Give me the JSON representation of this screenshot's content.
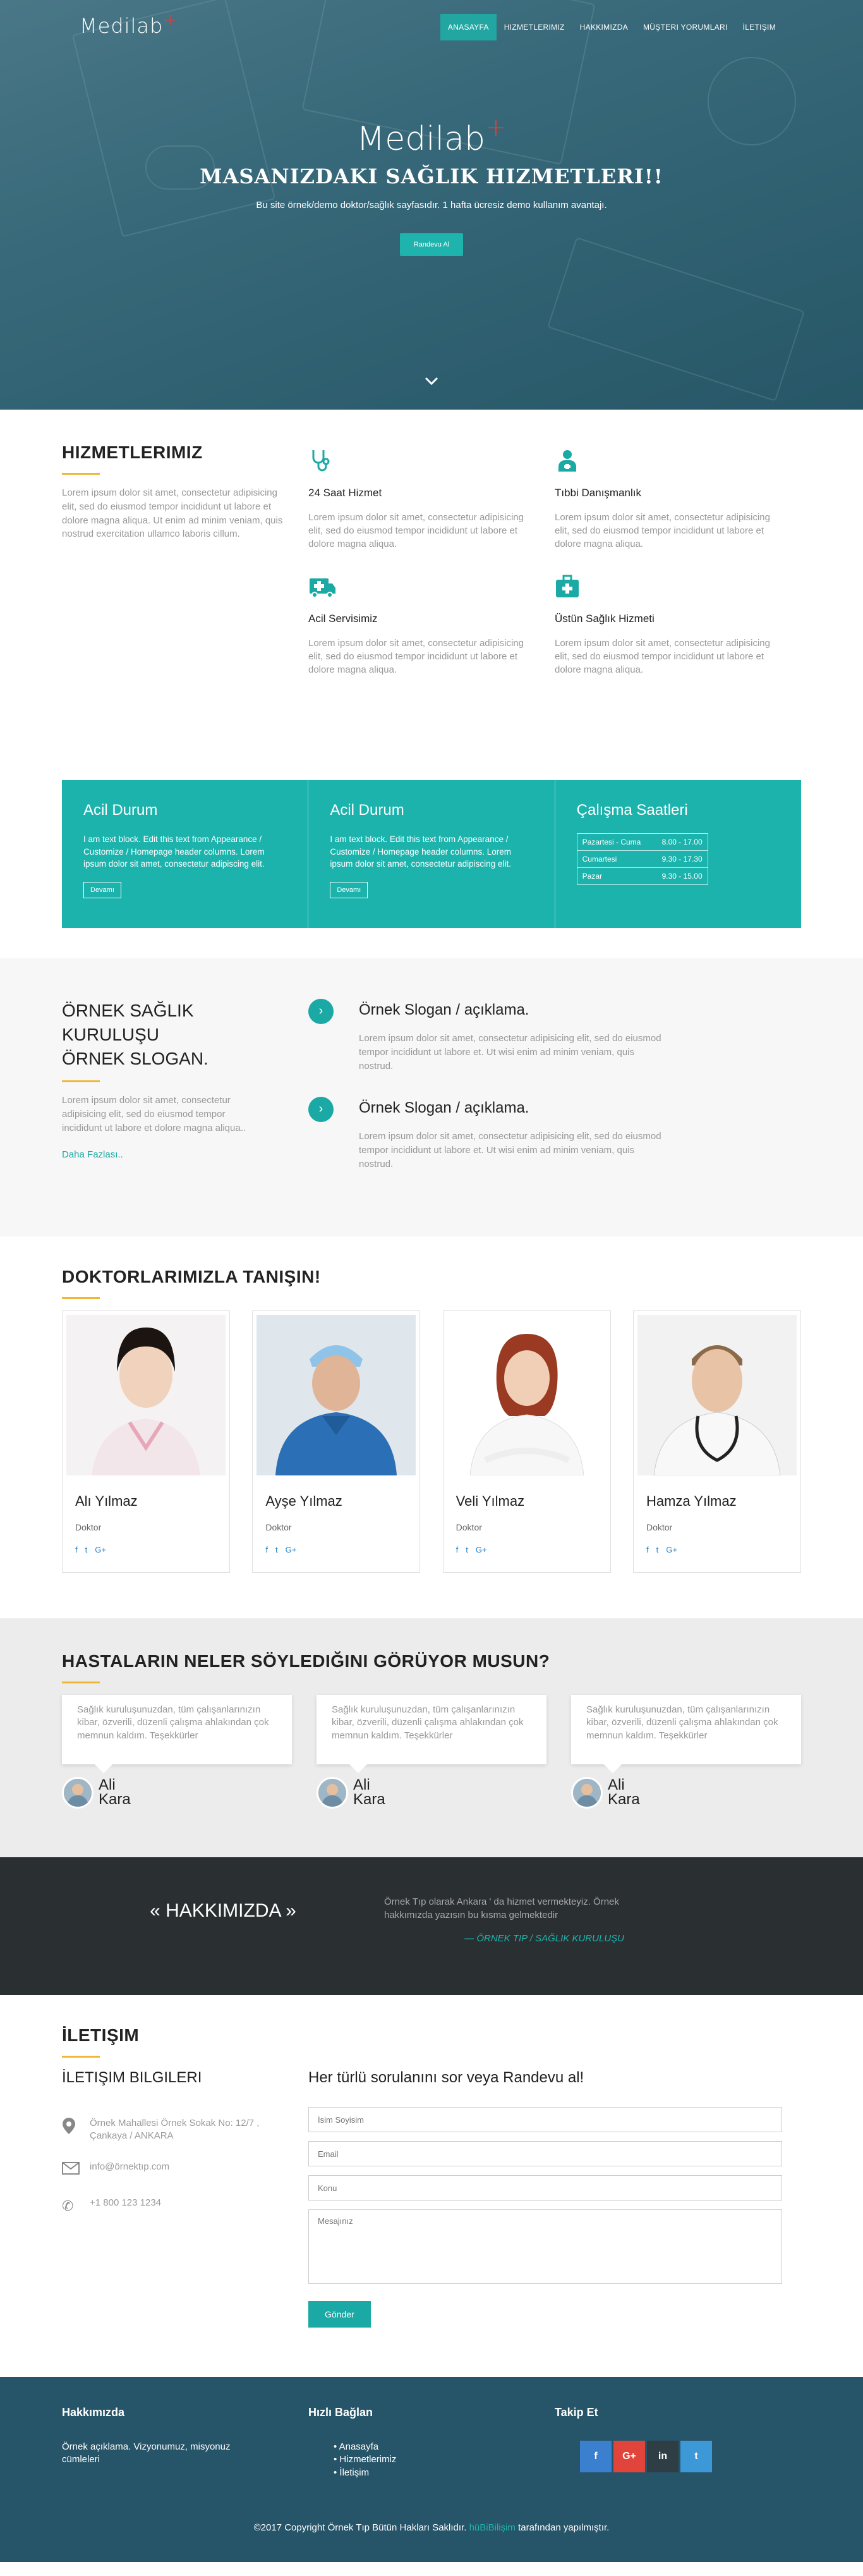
{
  "nav": {
    "brand": "Medilab",
    "items": [
      "ANASAYFA",
      "HIZMETLERIMIZ",
      "HAKKIMIZDA",
      "MÜŞTERI YORUMLARI",
      "İLETIŞIM"
    ]
  },
  "hero": {
    "brand": "Medilab",
    "title": "MASANIZDAKI SAĞLIK HIZMETLERI!!",
    "subtitle": "Bu site örnek/demo doktor/sağlık sayfasıdır. 1 hafta ücresiz demo kullanım avantajı.",
    "button": "Randevu Al"
  },
  "services": {
    "title": "HIZMETLERIMIZ",
    "intro": "Lorem ipsum dolor sit amet, consectetur adipisicing elit, sed do eiusmod tempor incididunt ut labore et dolore magna aliqua. Ut enim ad minim veniam, quis nostrud exercitation ullamco laboris cillum.",
    "items": [
      {
        "title": "24 Saat Hizmet",
        "text": "Lorem ipsum dolor sit amet, consectetur adipisicing elit, sed do eiusmod tempor incididunt ut labore et dolore magna aliqua.",
        "icon": "stethoscope-icon"
      },
      {
        "title": "Tıbbi Danışmanlık",
        "text": "Lorem ipsum dolor sit amet, consectetur adipisicing elit, sed do eiusmod tempor incididunt ut labore et dolore magna aliqua.",
        "icon": "doctor-icon"
      },
      {
        "title": "Acil Servisimiz",
        "text": "Lorem ipsum dolor sit amet, consectetur adipisicing elit, sed do eiusmod tempor incididunt ut labore et dolore magna aliqua.",
        "icon": "ambulance-icon"
      },
      {
        "title": "Üstün Sağlık Hizmeti",
        "text": "Lorem ipsum dolor sit amet, consectetur adipisicing elit, sed do eiusmod tempor incididunt ut labore et dolore magna aliqua.",
        "icon": "medkit-icon"
      }
    ]
  },
  "infobox": {
    "boxes": [
      {
        "title": "Acil Durum",
        "text": "I am text block. Edit this text from Appearance / Customize / Homepage header columns. Lorem ipsum dolor sit amet, consectetur adipiscing elit.",
        "button": "Devamı"
      },
      {
        "title": "Acil Durum",
        "text": "I am text block. Edit this text from Appearance / Customize / Homepage header columns. Lorem ipsum dolor sit amet, consectetur adipiscing elit.",
        "button": "Devamı"
      }
    ],
    "hours_title": "Çalışma Saatleri",
    "hours": [
      {
        "day": "Pazartesi - Cuma",
        "time": "8.00 - 17.00"
      },
      {
        "day": "Cumartesi",
        "time": "9.30 - 17.30"
      },
      {
        "day": "Pazar",
        "time": "9.30 - 15.00"
      }
    ]
  },
  "slogan": {
    "title_lines": [
      "ÖRNEK SAĞLIK",
      "KURULUŞU",
      "ÖRNEK SLOGAN."
    ],
    "text": "Lorem ipsum dolor sit amet, consectetur adipisicing elit, sed do eiusmod tempor incididunt ut labore et dolore magna aliqua..",
    "link": "Daha Fazlası..",
    "items": [
      {
        "title": "Örnek Slogan / açıklama.",
        "text": "Lorem ipsum dolor sit amet, consectetur adipisicing elit, sed do eiusmod tempor incididunt ut labore et. Ut wisi enim ad minim veniam, quis nostrud."
      },
      {
        "title": "Örnek Slogan / açıklama.",
        "text": "Lorem ipsum dolor sit amet, consectetur adipisicing elit, sed do eiusmod tempor incididunt ut labore et. Ut wisi enim ad minim veniam, quis nostrud."
      }
    ]
  },
  "doctors": {
    "title": "DOKTORLARIMIZLA TANIŞIN!",
    "list": [
      {
        "name": "Alı Yılmaz",
        "role": "Doktor"
      },
      {
        "name": "Ayşe Yılmaz",
        "role": "Doktor"
      },
      {
        "name": "Veli Yılmaz",
        "role": "Doktor"
      },
      {
        "name": "Hamza Yılmaz",
        "role": "Doktor"
      }
    ]
  },
  "testimonials": {
    "title": "HASTALARIN NELER SÖYLEDIĞINI GÖRÜYOR MUSUN?",
    "items": [
      {
        "text": "Sağlık kuruluşunuzdan, tüm çalışanlarınızın kibar, özverili, düzenli çalışma ahlakından çok memnun kaldım. Teşekkürler",
        "first": "Ali",
        "last": "Kara"
      },
      {
        "text": "Sağlık kuruluşunuzdan, tüm çalışanlarınızın kibar, özverili, düzenli çalışma ahlakından çok memnun kaldım. Teşekkürler",
        "first": "Ali",
        "last": "Kara"
      },
      {
        "text": "Sağlık kuruluşunuzdan, tüm çalışanlarınızın kibar, özverili, düzenli çalışma ahlakından çok memnun kaldım. Teşekkürler",
        "first": "Ali",
        "last": "Kara"
      }
    ]
  },
  "about": {
    "title": "« HAKKIMIZDA »",
    "text": "Örnek Tıp olarak Ankara ' da hizmet vermekteyiz. Örnek hakkımızda yazısın bu kısma gelmektedir",
    "signature": "— ÖRNEK TIP / SAĞLIK KURULUŞU"
  },
  "contact": {
    "title": "İLETIŞIM",
    "info_title": "İLETIŞIM BILGILERI",
    "address": "Örnek Mahallesi Örnek Sokak No: 12/7 , Çankaya / ANKARA",
    "email": "info@örnektıp.com",
    "phone": "+1 800 123 1234",
    "form_title": "Her türlü sorulanını sor veya Randevu al!",
    "placeholders": {
      "name": "İsim Soyisim",
      "email": "Email",
      "subject": "Konu",
      "message": "Mesajınız"
    },
    "send": "Gönder"
  },
  "footer": {
    "about_title": "Hakkımızda",
    "about_text": "Örnek açıklama. Vizyonumuz, misyonuz cümleleri",
    "links_title": "Hızlı Bağlan",
    "links": [
      "Anasayfa",
      "Hizmetlerimiz",
      "İletişim"
    ],
    "follow_title": "Takip Et",
    "social": [
      {
        "label": "f",
        "color": "#3b7fcf"
      },
      {
        "label": "G+",
        "color": "#e0443a"
      },
      {
        "label": "in",
        "color": "#2f3d44"
      },
      {
        "label": "t",
        "color": "#3d98d8"
      }
    ],
    "copyright_pre": "©2017 Copyright Örnek Tıp Bütün Hakları Saklıdır.",
    "copyright_link": "hüBiBilişim",
    "copyright_post": "tarafından yapılmıştır."
  },
  "colors": {
    "accent": "#1aa9a4",
    "underline": "#f2b632",
    "footer": "#265468",
    "about_bg": "#2a2f31"
  }
}
